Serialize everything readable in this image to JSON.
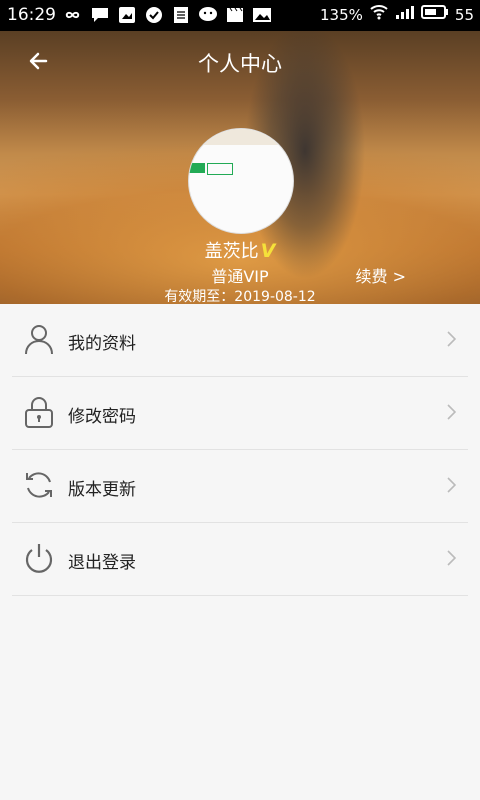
{
  "status_bar": {
    "time": "16:29",
    "battery_percent_text": "135%",
    "battery_level": "55"
  },
  "header": {
    "title": "个人中心",
    "username": "盖茨比",
    "vip_badge": "V",
    "level": "普通VIP",
    "renew_label": "续费 >",
    "expire_text": "有效期至：2019-08-12"
  },
  "menu": {
    "items": [
      {
        "label": "我的资料",
        "icon": "person-icon"
      },
      {
        "label": "修改密码",
        "icon": "lock-icon"
      },
      {
        "label": "版本更新",
        "icon": "refresh-icon"
      },
      {
        "label": "退出登录",
        "icon": "power-icon"
      }
    ]
  },
  "colors": {
    "status_bar_bg": "#000000",
    "page_bg": "#f6f6f6",
    "vip_badge": "#f5e13a"
  }
}
